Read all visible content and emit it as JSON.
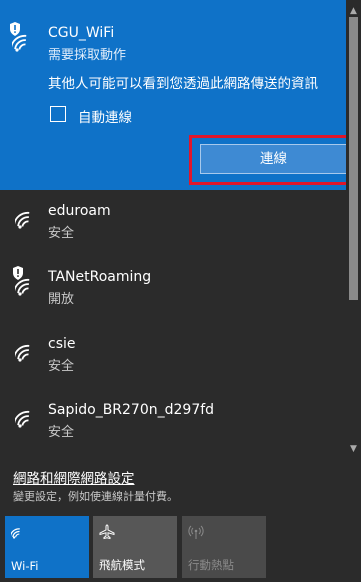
{
  "selected_network": {
    "name": "CGU_WiFi",
    "status": "需要採取動作",
    "warning": "其他人可能可以看到您透過此網路傳送的資訊",
    "auto_connect_label": "自動連線",
    "auto_connect_checked": false,
    "connect_button": "連線",
    "secured_warning_icon": "shield-icon"
  },
  "networks": [
    {
      "name": "eduroam",
      "status": "安全",
      "shield": false
    },
    {
      "name": "TANetRoaming",
      "status": "開放",
      "shield": true
    },
    {
      "name": "csie",
      "status": "安全",
      "shield": false
    },
    {
      "name": "Sapido_BR270n_d297fd",
      "status": "安全",
      "shield": false
    }
  ],
  "settings": {
    "link": "網路和網際網路設定",
    "description": "變更設定，例如使連線計量付費。"
  },
  "quick_actions": [
    {
      "label": "Wi-Fi",
      "icon": "wifi-icon",
      "active": true
    },
    {
      "label": "飛航模式",
      "icon": "airplane-icon",
      "active": false
    },
    {
      "label": "行動熱點",
      "icon": "hotspot-icon",
      "active": false,
      "disabled": true
    }
  ],
  "colors": {
    "accent": "#0f72c8",
    "highlight_box": "#e0162b",
    "background": "#2b2b2b"
  }
}
